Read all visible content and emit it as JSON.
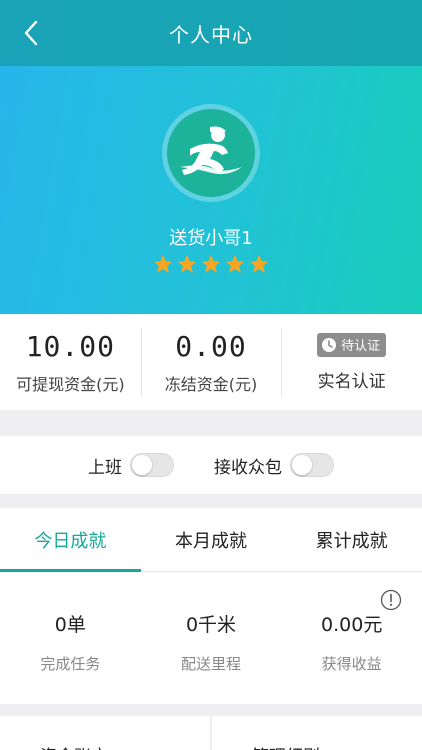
{
  "header": {
    "title": "个人中心",
    "back_icon": "chevron-left-icon"
  },
  "profile": {
    "name": "送货小哥1",
    "rating": 5,
    "avatar_icon": "running-courier-icon"
  },
  "stats": [
    {
      "value": "10.00",
      "label": "可提现资金(元)"
    },
    {
      "value": "0.00",
      "label": "冻结资金(元)"
    }
  ],
  "verification": {
    "badge": "待认证",
    "label": "实名认证",
    "badge_icon": "clock-icon"
  },
  "toggles": [
    {
      "label": "上班",
      "on": false
    },
    {
      "label": "接收众包",
      "on": false
    }
  ],
  "tabs": [
    {
      "label": "今日成就",
      "active": true
    },
    {
      "label": "本月成就",
      "active": false
    },
    {
      "label": "累计成就",
      "active": false
    }
  ],
  "achievements": [
    {
      "value": "0单",
      "label": "完成任务"
    },
    {
      "value": "0千米",
      "label": "配送里程"
    },
    {
      "value": "0.00元",
      "label": "获得收益"
    }
  ],
  "bottom_cards": [
    "资金账户",
    "管理细则"
  ],
  "colors": {
    "accent": "#16a89a",
    "header": "#1aa3b8",
    "star": "#f5a623"
  }
}
